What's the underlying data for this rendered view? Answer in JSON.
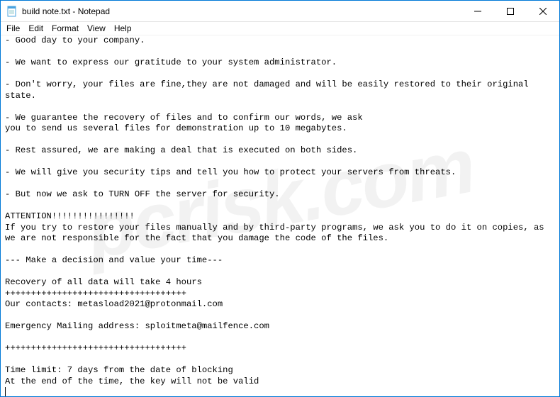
{
  "window": {
    "title": "build note.txt - Notepad",
    "icon": "notepad-icon"
  },
  "controls": {
    "minimize": "minimize",
    "maximize": "maximize",
    "close": "close"
  },
  "menubar": {
    "items": [
      {
        "label": "File"
      },
      {
        "label": "Edit"
      },
      {
        "label": "Format"
      },
      {
        "label": "View"
      },
      {
        "label": "Help"
      }
    ]
  },
  "document": {
    "text": "- Good day to your company.\n\n- We want to express our gratitude to your system administrator.\n\n- Don't worry, your files are fine,they are not damaged and will be easily restored to their original state.\n\n- We guarantee the recovery of files and to confirm our words, we ask\nyou to send us several files for demonstration up to 10 megabytes.\n\n- Rest assured, we are making a deal that is executed on both sides.\n\n- We will give you security tips and tell you how to protect your servers from threats.\n\n- But now we ask to TURN OFF the server for security.\n\nATTENTION!!!!!!!!!!!!!!!!\nIf you try to restore your files manually and by third-party programs, we ask you to do it on copies, as we are not responsible for the fact that you damage the code of the files.\n\n--- Make a decision and value your time---\n\nRecovery of all data will take 4 hours\n+++++++++++++++++++++++++++++++++++\nOur contacts: metasload2021@protonmail.com\n\nEmergency Mailing address: sploitmeta@mailfence.com\n\n+++++++++++++++++++++++++++++++++++\n\nTime limit: 7 days from the date of blocking\nAt the end of the time, the key will not be valid"
  },
  "watermark": {
    "text": "pcrisk.com"
  }
}
